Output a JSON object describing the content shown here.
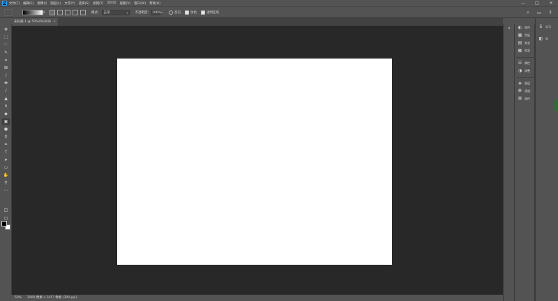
{
  "app": {
    "logo_text": "Ps"
  },
  "menu": [
    "文件(F)",
    "编辑(E)",
    "图像(I)",
    "图层(L)",
    "文字(Y)",
    "选择(S)",
    "滤镜(T)",
    "3D(D)",
    "视图(V)",
    "窗口(W)",
    "帮助(H)"
  ],
  "window_controls": {
    "minimize": "—",
    "maximize": "□",
    "close": "✕"
  },
  "options": {
    "mode_label": "模式:",
    "mode_value": "正常",
    "opacity_label": "不透明度:",
    "opacity_value": "100%",
    "reverse_label": "反向",
    "dither_label": "仿色",
    "transparency_label": "透明区域",
    "dither_checked": true,
    "transparency_checked": true
  },
  "document_tab": {
    "title": "未标题-1 @ 50%(RGB/8)",
    "close": "×"
  },
  "status": {
    "zoom": "50%",
    "doc_info": "2000 像素 x 1417 像素 (300 ppi)"
  },
  "right_panels": [
    {
      "icon": "color-icon",
      "label": "颜色"
    },
    {
      "icon": "swatches-icon",
      "label": "色板"
    },
    {
      "icon": "gradient-icon",
      "label": "渐变"
    },
    {
      "icon": "patterns-icon",
      "label": "图案"
    },
    {
      "icon": "properties-icon",
      "label": "属性"
    },
    {
      "icon": "adjustments-icon",
      "label": "调整"
    },
    {
      "icon": "layers-icon",
      "label": "图层"
    },
    {
      "icon": "channels-icon",
      "label": "通道"
    },
    {
      "icon": "paths-icon",
      "label": "路径"
    }
  ],
  "learn_panels": [
    {
      "icon": "learn-icon",
      "label": "学习"
    },
    {
      "icon": "libraries-icon",
      "label": "库"
    }
  ],
  "colors": {
    "workspace": "#282828",
    "canvas": "#ffffff",
    "chrome": "#535353"
  }
}
